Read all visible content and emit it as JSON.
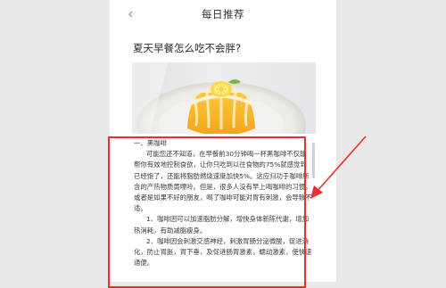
{
  "nav": {
    "title": "每日推荐",
    "back_icon": "chevron-left-icon"
  },
  "article": {
    "title": "夏天早餐怎么吃不会胖?",
    "paragraphs": [
      "一、黑咖啡",
      "可能您还不知道，在早餐前30分钟喝一杯黑咖啡不仅能帮你有效地控制食欲，让你只吃到以往食物的75%就感觉到已经饱了，还能将脂肪燃烧速度加快5%。这应归功于咖啡所含的产热物质黄嘌呤。但是，很多人没有早上喝咖啡的习惯，或者是如果不好的朋友，喝了咖啡可能对胃有刺激，会导致不适。",
      "1、咖啡因可以加速脂肪分解，增快身体新陈代谢，增加热消耗，有助减脂瘦身。",
      "2、咖啡因会刺激交感神经，刺激胃肠分泌微酸，促进消化，防止胃胀，胃下垂，及促进肠胃激素，蠕动激素，使快速通便。"
    ]
  },
  "colors": {
    "annotation": "#e8322f",
    "background": "#e9e9e9",
    "page": "#ffffff"
  }
}
